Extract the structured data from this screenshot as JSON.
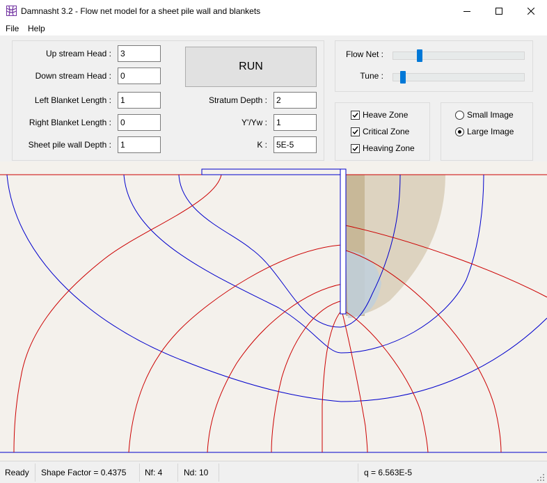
{
  "window": {
    "title": "Damnasht 3.2  -  Flow net model for a sheet pile wall and blankets"
  },
  "menu": {
    "file": "File",
    "help": "Help"
  },
  "params": {
    "upstream_head": {
      "label": "Up stream Head :",
      "value": "3"
    },
    "downstream_head": {
      "label": "Down stream Head :",
      "value": "0"
    },
    "left_blanket": {
      "label": "Left Blanket Length :",
      "value": "1"
    },
    "right_blanket": {
      "label": "Right Blanket Length :",
      "value": "0"
    },
    "sheet_pile_depth": {
      "label": "Sheet pile wall Depth :",
      "value": "1"
    },
    "stratum_depth": {
      "label": "Stratum Depth :",
      "value": "2"
    },
    "gamma_ratio": {
      "label": "Y'/Yw :",
      "value": "1"
    },
    "k": {
      "label": "K :",
      "value": "5E-5"
    }
  },
  "run_label": "RUN",
  "sliders": {
    "flow_net": {
      "label": "Flow Net :",
      "level": 0.19
    },
    "tune": {
      "label": "Tune :",
      "level": 0.06
    }
  },
  "checkboxes": {
    "heave": {
      "label": "Heave Zone",
      "checked": true
    },
    "critical": {
      "label": "Critical Zone",
      "checked": true
    },
    "heaving": {
      "label": "Heaving Zone",
      "checked": true
    }
  },
  "image_size": {
    "small": {
      "label": "Small Image",
      "selected": false
    },
    "large": {
      "label": "Large Image",
      "selected": true
    }
  },
  "status": {
    "state": "Ready",
    "shape_factor": "Shape Factor = 0.4375",
    "nf": "Nf: 4",
    "nd": "Nd: 10",
    "q": "q = 6.563E-5"
  },
  "colors": {
    "equipotential": "#cc0000",
    "flowline": "#0000cc",
    "accent": "#0078d7",
    "canvas_bg": "#f4f1ec"
  }
}
